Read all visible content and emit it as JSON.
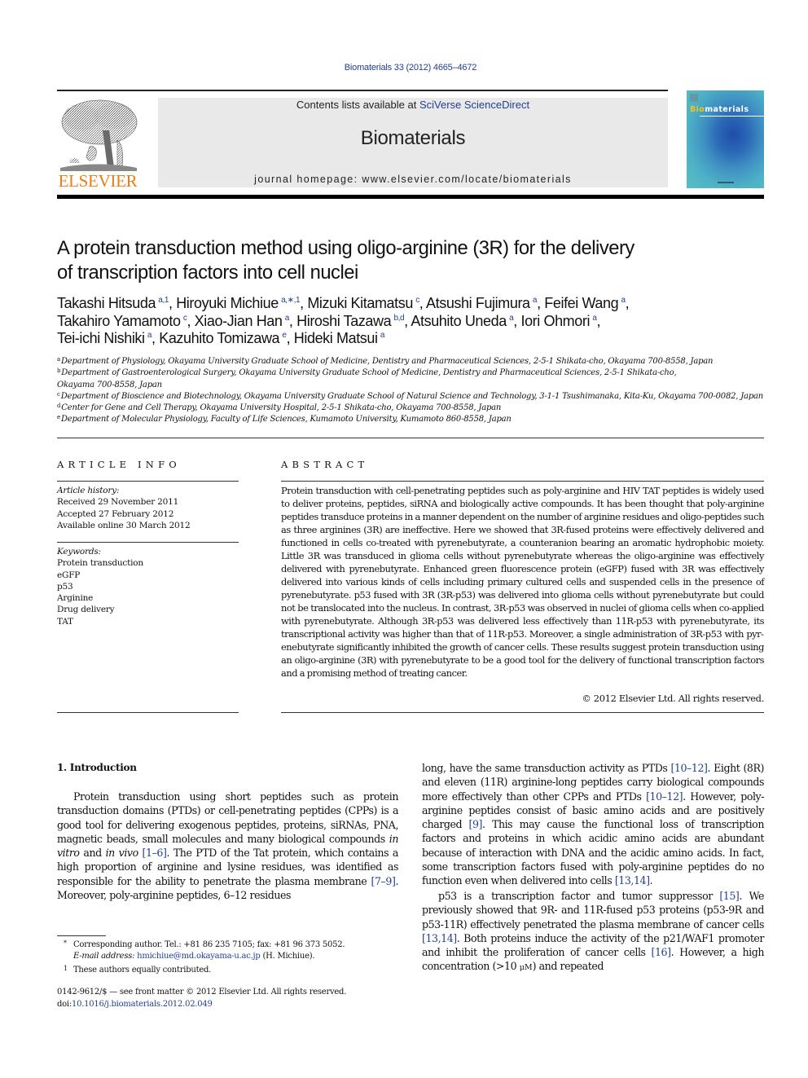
{
  "header": {
    "journal_ref": "Biomaterials 33 (2012) 4665–4672",
    "contents_prefix": "Contents lists available at ",
    "contents_link": "SciVerse ScienceDirect",
    "journal_name": "Biomaterials",
    "homepage": "journal homepage: www.elsevier.com/locate/biomaterials",
    "publisher_logo_text": "ELSEVIER",
    "cover": {
      "title_accent": "Bio",
      "title_rest": "materials",
      "accent_color": "#f2c417"
    },
    "colors": {
      "link": "#1f3f8f",
      "elsevier_orange": "#f07b12",
      "masthead_gray": "#e9e9e9"
    }
  },
  "article": {
    "title_line1": "A protein transduction method using oligo-arginine (3R) for the delivery",
    "title_line2": "of transcription factors into cell nuclei",
    "authors": [
      {
        "name": "Takashi Hitsuda",
        "aff": "a,1",
        "sep": ", "
      },
      {
        "name": "Hiroyuki Michiue",
        "aff": "a,∗,1",
        "sep": ", "
      },
      {
        "name": "Mizuki Kitamatsu",
        "aff": "c",
        "sep": ", "
      },
      {
        "name": "Atsushi Fujimura",
        "aff": "a",
        "sep": ", "
      },
      {
        "name": "Feifei Wang",
        "aff": "a",
        "sep": ","
      },
      {
        "name": "Takahiro Yamamoto",
        "aff": "c",
        "sep": ", "
      },
      {
        "name": "Xiao-Jian Han",
        "aff": "a",
        "sep": ", "
      },
      {
        "name": "Hiroshi Tazawa",
        "aff": "b,d",
        "sep": ", "
      },
      {
        "name": "Atsuhito Uneda",
        "aff": "a",
        "sep": ", "
      },
      {
        "name": "Iori Ohmori",
        "aff": "a",
        "sep": ","
      },
      {
        "name": "Tei-ichi Nishiki",
        "aff": "a",
        "sep": ", "
      },
      {
        "name": "Kazuhito Tomizawa",
        "aff": "e",
        "sep": ", "
      },
      {
        "name": "Hideki Matsui",
        "aff": "a",
        "sep": ""
      }
    ],
    "affiliations": [
      {
        "key": "a",
        "text": "Department of Physiology, Okayama University Graduate School of Medicine, Dentistry and Pharmaceutical Sciences, 2-5-1 Shikata-cho, Okayama 700-8558, Japan"
      },
      {
        "key": "b",
        "text": "Department of Gastroenterological Surgery, Okayama University Graduate School of Medicine, Dentistry and Pharmaceutical Sciences, 2-5-1 Shikata-cho,",
        "text_cont": "Okayama 700-8558, Japan"
      },
      {
        "key": "c",
        "text": "Department of Bioscience and Biotechnology, Okayama University Graduate School of Natural Science and Technology, 3-1-1 Tsushimanaka, Kita-Ku, Okayama 700-0082, Japan"
      },
      {
        "key": "d",
        "text": "Center for Gene and Cell Therapy, Okayama University Hospital, 2-5-1 Shikata-cho, Okayama 700-8558, Japan"
      },
      {
        "key": "e",
        "text": "Department of Molecular Physiology, Faculty of Life Sciences, Kumamoto University, Kumamoto 860-8558, Japan"
      }
    ]
  },
  "article_info": {
    "heading": "ARTICLE INFO",
    "history_label": "Article history:",
    "history": [
      "Received 29 November 2011",
      "Accepted 27 February 2012",
      "Available online 30 March 2012"
    ],
    "keywords_label": "Keywords:",
    "keywords": [
      "Protein transduction",
      "eGFP",
      "p53",
      "Arginine",
      "Drug delivery",
      "TAT"
    ]
  },
  "abstract": {
    "heading": "ABSTRACT",
    "text": "Protein transduction with cell-penetrating peptides such as poly-arginine and HIV TAT peptides is widely used to deliver proteins, peptides, siRNA and biologically active compounds. It has been thought that poly-arginine peptides transduce proteins in a manner dependent on the number of arginine residues and oligo-peptides such as three arginines (3R) are ineffective. Here we showed that 3R-fused proteins were effectively delivered and functioned in cells co-treated with pyrenebutyrate, a counteranion bearing an aromatic hydrophobic moiety. Little 3R was transduced in glioma cells without pyr­enebutyrate whereas the oligo-arginine was effectively delivered with pyrenebutyrate. Enhanced green fluorescence protein (eGFP) fused with 3R was effectively delivered into various kinds of cells including primary cultured cells and suspended cells in the presence of pyrenebutyrate. p53 fused with 3R (3R-p53) was delivered into glioma cells without pyrenebutyrate but could not be translocated into the nucleus. In contrast, 3R-p53 was observed in nuclei of glioma cells when co-applied with pyrenebutyrate. Although 3R-p53 was delivered less effectively than 11R-p53 with pyrenebutyrate, its transcriptional activity was higher than that of 11R-p53. Moreover, a single administration of 3R-p53 with pyr­enebutyrate significantly inhibited the growth of cancer cells. These results suggest protein transduction using an oligo-arginine (3R) with pyrenebutyrate to be a good tool for the delivery of functional tran­scription factors and a promising method of treating cancer.",
    "copyright": "© 2012 Elsevier Ltd. All rights reserved."
  },
  "body": {
    "intro_heading": "1.  Introduction",
    "left": {
      "s1": "Protein transduction using short peptides such as protein transduction domains (PTDs) or cell-penetrating peptides (CPPs) is a good tool for delivering exogenous peptides, proteins, siRNAs, PNA, magnetic beads, small molecules and many biological compounds ",
      "i1": "in vitro",
      "s2": " and ",
      "i2": "in vivo",
      "s3": " ",
      "c1": "[1–6]",
      "s4": ". The PTD of the Tat protein, which contains a high proportion of arginine and lysine residues, was identified as responsible for the ability to penetrate the plasma membrane ",
      "c2": "[7–9]",
      "s5": ". Moreover, poly-arginine peptides, 6–12 residues"
    },
    "right1": {
      "s1": "long, have the same transduction activity as PTDs ",
      "c1": "[10–12]",
      "s2": ". Eight (8R) and eleven (11R) arginine-long peptides carry biological compounds more effectively than other CPPs and PTDs ",
      "c2": "[10–12]",
      "s3": ". However, poly-arginine peptides consist of basic amino acids and are positively charged ",
      "c3": "[9]",
      "s4": ". This may cause the functional loss of transcription factors and proteins in which acidic amino acids are abundant because of interaction with DNA and the acidic amino acids. In fact, some transcription factors fused with poly-arginine peptides do no function even when delivered into cells ",
      "c4": "[13,14]",
      "s5": "."
    },
    "right2": {
      "s1": "p53 is a transcription factor and tumor suppressor ",
      "c1": "[15]",
      "s2": ". We previously showed that 9R- and 11R-fused p53 proteins (p53-9R and p53-11R) effectively penetrated the plasma membrane of cancer cells ",
      "c2": "[13,14]",
      "s3": ". Both proteins induce the activity of the p21/WAF1 promoter and inhibit the proliferation of cancer cells ",
      "c3": "[16]",
      "s4": ". However, a high concentration (>10 ",
      "unit": "μM",
      "s5": ") and repeated"
    }
  },
  "footnotes": {
    "corresponding_mark": "*",
    "corresponding": "Corresponding author. Tel.: +81 86 235 7105; fax: +81 96 373 5052.",
    "email_label": "E-mail address:",
    "email": "hmichiue@md.okayama-u.ac.jp",
    "email_suffix": " (H. Michiue).",
    "equal_mark": "1",
    "equal": "These authors equally contributed."
  },
  "front_matter": {
    "issn_line": "0142-9612/$ — see front matter © 2012 Elsevier Ltd. All rights reserved.",
    "doi_prefix": "doi:",
    "doi": "10.1016/j.biomaterials.2012.02.049"
  }
}
